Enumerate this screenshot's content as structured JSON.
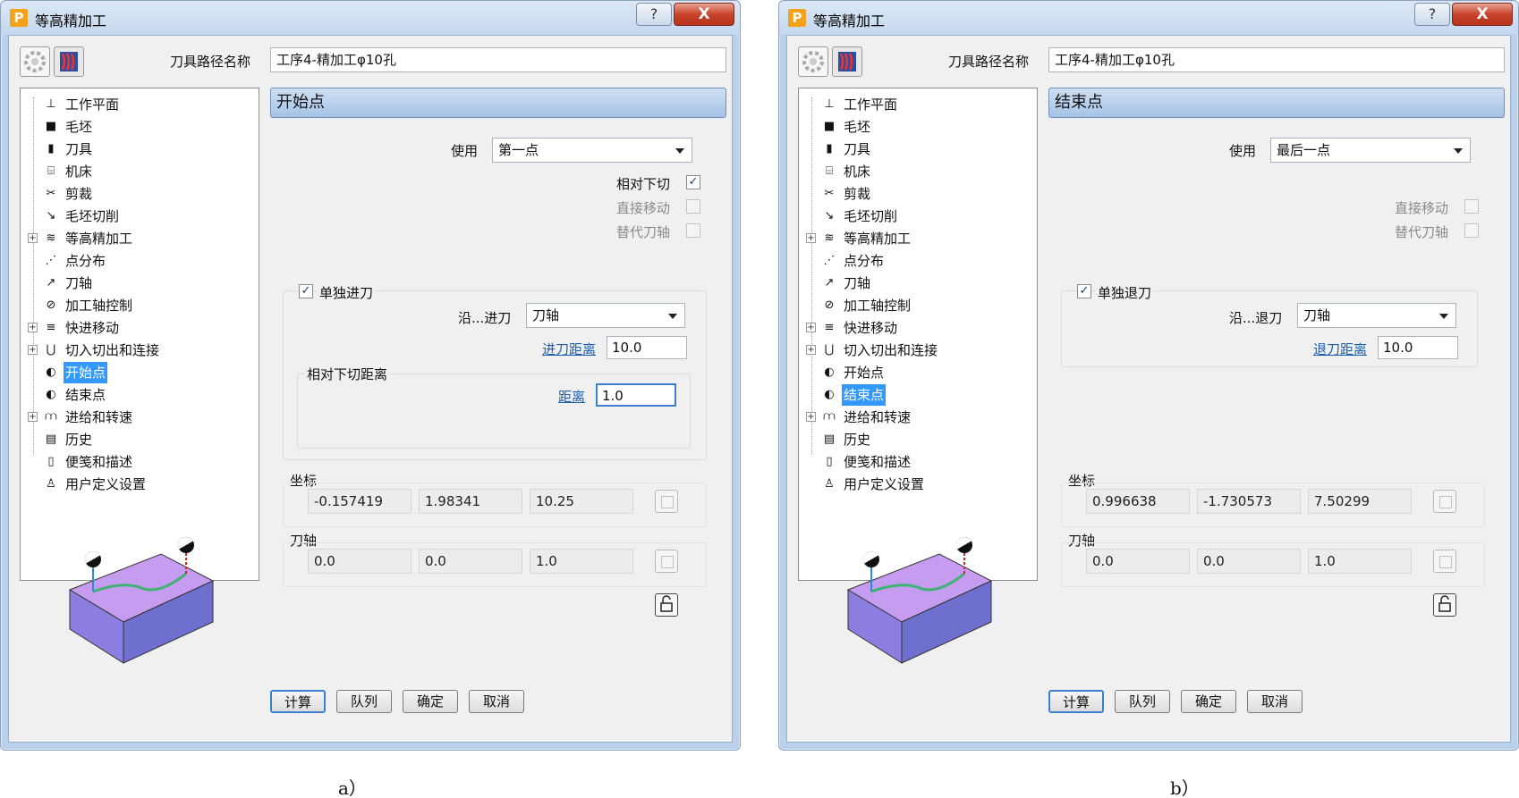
{
  "panels": [
    {
      "window_title": "等高精加工",
      "app_icon": "P",
      "help_label": "?",
      "close_label": "X",
      "path_label": "刀具路径名称",
      "path_value": "工序4-精加工φ10孔",
      "tree": [
        {
          "label": "工作平面",
          "icon": "workplane-icon",
          "glyph": "⊥",
          "expander": false
        },
        {
          "label": "毛坯",
          "icon": "block-icon",
          "glyph": "■",
          "expander": false
        },
        {
          "label": "刀具",
          "icon": "tool-icon",
          "glyph": "▮",
          "expander": false
        },
        {
          "label": "机床",
          "icon": "machine-icon",
          "glyph": "⌸",
          "expander": false
        },
        {
          "label": "剪裁",
          "icon": "limit-icon",
          "glyph": "✂",
          "expander": false
        },
        {
          "label": "毛坯切削",
          "icon": "stock-cut-icon",
          "glyph": "↘",
          "expander": false
        },
        {
          "label": "等高精加工",
          "icon": "constant-z-icon",
          "glyph": "≋",
          "expander": true
        },
        {
          "label": "点分布",
          "icon": "point-distribution-icon",
          "glyph": "⋰",
          "expander": false
        },
        {
          "label": "刀轴",
          "icon": "tool-axis-icon",
          "glyph": "↗",
          "expander": false
        },
        {
          "label": "加工轴控制",
          "icon": "axis-control-icon",
          "glyph": "⊘",
          "expander": false
        },
        {
          "label": "快进移动",
          "icon": "rapid-move-icon",
          "glyph": "≡",
          "expander": true
        },
        {
          "label": "切入切出和连接",
          "icon": "leads-links-icon",
          "glyph": "⋃",
          "expander": true
        },
        {
          "label": "开始点",
          "icon": "start-point-icon",
          "glyph": "◐",
          "expander": false
        },
        {
          "label": "结束点",
          "icon": "end-point-icon",
          "glyph": "◐",
          "expander": false
        },
        {
          "label": "进给和转速",
          "icon": "feeds-speeds-icon",
          "glyph": "⩋",
          "expander": true
        },
        {
          "label": "历史",
          "icon": "history-icon",
          "glyph": "▤",
          "expander": false
        },
        {
          "label": "便笺和描述",
          "icon": "notes-icon",
          "glyph": "▯",
          "expander": false
        },
        {
          "label": "用户定义设置",
          "icon": "user-settings-icon",
          "glyph": "♙",
          "expander": false
        }
      ],
      "selected_index": 12,
      "section_title": "开始点",
      "use_label": "使用",
      "use_value": "第一点",
      "relative_plunge_label": "相对下切",
      "relative_plunge_checked": "✓",
      "direct_move_label": "直接移动",
      "alt_axis_label": "替代刀轴",
      "separate_label": "单独进刀",
      "separate_checked": "✓",
      "along_label": "沿...进刀",
      "along_value": "刀轴",
      "distance_link": "进刀距离",
      "distance_value": "10.0",
      "plunge_group_label": "相对下切距离",
      "plunge_distance_link": "距离",
      "plunge_distance_value": "1.0",
      "coords_label": "坐标",
      "coords": [
        "-0.157419",
        "1.98341",
        "10.25"
      ],
      "axis_label": "刀轴",
      "axis": [
        "0.0",
        "0.0",
        "1.0"
      ],
      "buttons": {
        "calc": "计算",
        "queue": "队列",
        "ok": "确定",
        "cancel": "取消"
      }
    },
    {
      "window_title": "等高精加工",
      "app_icon": "P",
      "help_label": "?",
      "close_label": "X",
      "path_label": "刀具路径名称",
      "path_value": "工序4-精加工φ10孔",
      "tree": [
        {
          "label": "工作平面",
          "icon": "workplane-icon",
          "glyph": "⊥",
          "expander": false
        },
        {
          "label": "毛坯",
          "icon": "block-icon",
          "glyph": "■",
          "expander": false
        },
        {
          "label": "刀具",
          "icon": "tool-icon",
          "glyph": "▮",
          "expander": false
        },
        {
          "label": "机床",
          "icon": "machine-icon",
          "glyph": "⌸",
          "expander": false
        },
        {
          "label": "剪裁",
          "icon": "limit-icon",
          "glyph": "✂",
          "expander": false
        },
        {
          "label": "毛坯切削",
          "icon": "stock-cut-icon",
          "glyph": "↘",
          "expander": false
        },
        {
          "label": "等高精加工",
          "icon": "constant-z-icon",
          "glyph": "≋",
          "expander": true
        },
        {
          "label": "点分布",
          "icon": "point-distribution-icon",
          "glyph": "⋰",
          "expander": false
        },
        {
          "label": "刀轴",
          "icon": "tool-axis-icon",
          "glyph": "↗",
          "expander": false
        },
        {
          "label": "加工轴控制",
          "icon": "axis-control-icon",
          "glyph": "⊘",
          "expander": false
        },
        {
          "label": "快进移动",
          "icon": "rapid-move-icon",
          "glyph": "≡",
          "expander": true
        },
        {
          "label": "切入切出和连接",
          "icon": "leads-links-icon",
          "glyph": "⋃",
          "expander": true
        },
        {
          "label": "开始点",
          "icon": "start-point-icon",
          "glyph": "◐",
          "expander": false
        },
        {
          "label": "结束点",
          "icon": "end-point-icon",
          "glyph": "◐",
          "expander": false
        },
        {
          "label": "进给和转速",
          "icon": "feeds-speeds-icon",
          "glyph": "⩋",
          "expander": true
        },
        {
          "label": "历史",
          "icon": "history-icon",
          "glyph": "▤",
          "expander": false
        },
        {
          "label": "便笺和描述",
          "icon": "notes-icon",
          "glyph": "▯",
          "expander": false
        },
        {
          "label": "用户定义设置",
          "icon": "user-settings-icon",
          "glyph": "♙",
          "expander": false
        }
      ],
      "selected_index": 13,
      "section_title": "结束点",
      "use_label": "使用",
      "use_value": "最后一点",
      "direct_move_label": "直接移动",
      "alt_axis_label": "替代刀轴",
      "separate_label": "单独退刀",
      "separate_checked": "✓",
      "along_label": "沿...退刀",
      "along_value": "刀轴",
      "distance_link": "退刀距离",
      "distance_value": "10.0",
      "coords_label": "坐标",
      "coords": [
        "0.996638",
        "-1.730573",
        "7.50299"
      ],
      "axis_label": "刀轴",
      "axis": [
        "0.0",
        "0.0",
        "1.0"
      ],
      "buttons": {
        "calc": "计算",
        "queue": "队列",
        "ok": "确定",
        "cancel": "取消"
      }
    }
  ],
  "captions": [
    "a）",
    "b）"
  ],
  "colors": {
    "selection": "#3399ff",
    "header": "#a5c3e6",
    "link": "#1a5fb4",
    "block_top": "#c59cf0",
    "block_side": "#6f6fcf",
    "toolpath": "#3cb371"
  }
}
